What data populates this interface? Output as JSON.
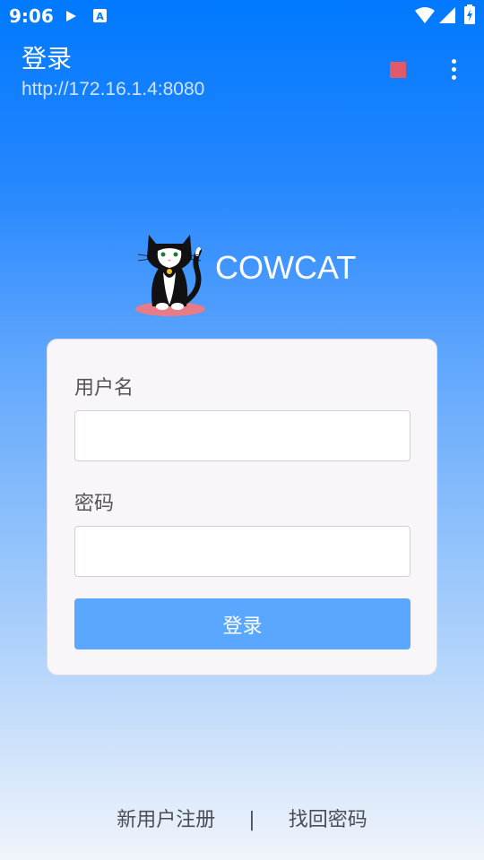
{
  "status_bar": {
    "time": "9:06"
  },
  "app_bar": {
    "title": "登录",
    "url": "http://172.16.1.4:8080"
  },
  "logo": {
    "brand_name": "COWCAT"
  },
  "form": {
    "username_label": "用户名",
    "username_value": "",
    "password_label": "密码",
    "password_value": "",
    "submit_label": "登录"
  },
  "footer": {
    "register_label": "新用户注册",
    "separator": "|",
    "recover_label": "找回密码"
  },
  "colors": {
    "primary": "#0079FE",
    "button": "#59A7FE",
    "stop": "#E05A6A"
  }
}
